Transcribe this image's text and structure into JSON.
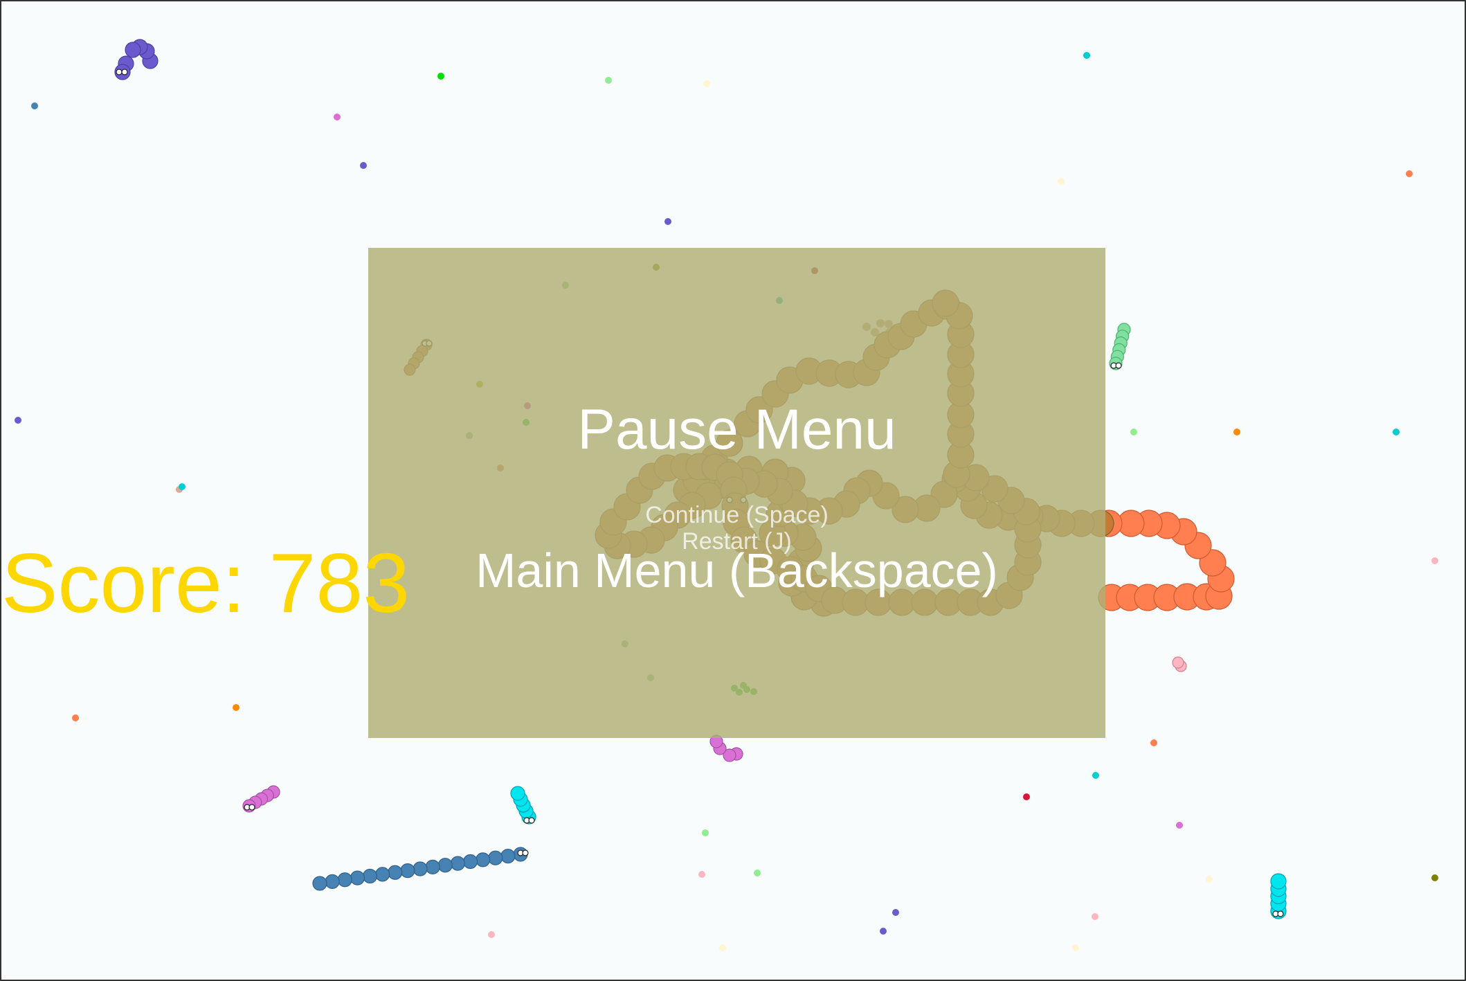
{
  "pause_menu": {
    "title": "Pause Menu",
    "continue_label": "Continue (Space)",
    "restart_label": "Restart (J)",
    "main_menu_label": "Main Menu (Backspace)"
  },
  "score": {
    "label": "Score: 783"
  },
  "colors": {
    "overlay": "#b0ae74",
    "score": "#ffd700",
    "menu_text": "#ffffff",
    "player_snake": "#c87a35",
    "enemy_orange": "#ff7f50",
    "background": "#f8fcfc"
  }
}
